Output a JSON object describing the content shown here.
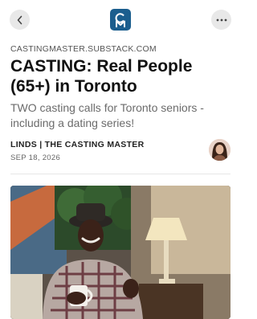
{
  "header": {
    "back_icon": "chevron-left-icon",
    "logo_icon": "casting-master-logo",
    "more_icon": "more-horizontal-icon"
  },
  "post": {
    "source": "CASTINGMASTER.SUBSTACK.COM",
    "title": "CASTING: Real People (65+) in Toronto",
    "subtitle": "TWO casting calls for Toronto seniors - including a dating series!",
    "author": "LINDS | THE CASTING MASTER",
    "date": "SEP 18, 2026"
  },
  "colors": {
    "accent": "#1b5e8e",
    "button_bg": "#e8e8e8",
    "muted_text": "#6b6b6b"
  }
}
